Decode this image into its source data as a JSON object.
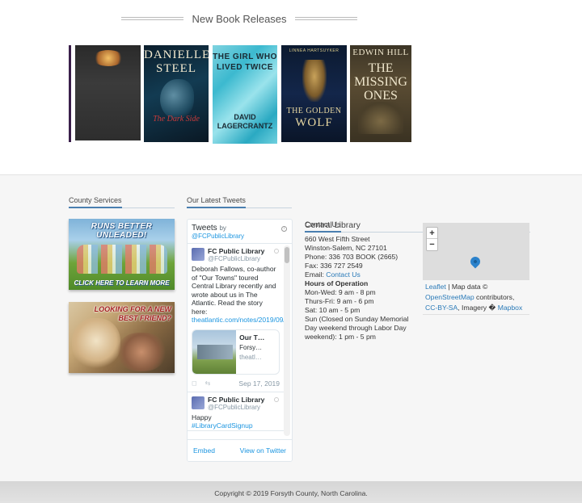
{
  "releases": {
    "title": "New Book Releases",
    "books": [
      {
        "title": "",
        "author": ""
      },
      {
        "author_line": "DANIELLE STEEL",
        "title": "The Dark Side"
      },
      {
        "title": "THE GIRL WHO LIVED TWICE",
        "author": "DAVID LAGERCRANTZ"
      },
      {
        "author": "LINNEA HARTSUYKER",
        "title_small": "THE GOLDEN",
        "title_big": "WOLF"
      },
      {
        "author": "EDWIN HILL",
        "title": "THE MISSING ONES"
      }
    ]
  },
  "county": {
    "title": "County Services",
    "promo1": {
      "headline": "RUNS BETTER UNLEADED!",
      "footer": "CLICK HERE TO LEARN MORE"
    },
    "promo2": {
      "headline": "LOOKING FOR A NEW BEST FRIEND?"
    }
  },
  "tweets": {
    "title": "Our Latest Tweets",
    "header_label": "Tweets",
    "header_by": "by",
    "header_handle": "@FCPublicLibrary",
    "info_icon": "i",
    "tweet1": {
      "name": "FC Public Library",
      "handle": "@FCPublicLibrary",
      "text": "Deborah Fallows, co-author of \"Our Towns\" toured Central Library recently and wrote about us in The Atlantic. Read the story here:",
      "link": "theatlantic.com/notes/2019/09/…",
      "card_title": "Our T…",
      "card_desc": "Forsy…",
      "card_url": "theatl…",
      "date": "Sep 17, 2019"
    },
    "tweet2": {
      "name": "FC Public Library",
      "handle": "@FCPublicLibrary",
      "text": "Happy",
      "hashtag": "#LibraryCardSignup"
    },
    "embed": "Embed",
    "view": "View on Twitter"
  },
  "contact": {
    "title": "Contact Us",
    "library": "Central Library",
    "address1": "660 West Fifth Street",
    "address2": "Winston-Salem, NC 27101",
    "phone": "Phone: 336 703 BOOK (2665)",
    "fax": "Fax: 336 727 2549",
    "email_label": "Email:",
    "email_link": "Contact Us",
    "hours_title": "Hours of Operation",
    "hours": [
      "Mon-Wed: 9 am - 8 pm",
      "Thurs-Fri: 9 am - 6 pm",
      "Sat: 10 am - 5 pm",
      "Sun (Closed on Sunday Memorial Day weekend through Labor Day weekend): 1 pm - 5 pm"
    ]
  },
  "map": {
    "zoom_in": "+",
    "zoom_out": "−",
    "attribution": {
      "leaflet": "Leaflet",
      "sep1": " | Map data © ",
      "osm": "OpenStreetMap",
      "contrib": " contributors, ",
      "ccbysa": "CC-BY-SA",
      "imagery": ", Imagery � ",
      "mapbox": "Mapbox"
    }
  },
  "footer": {
    "copyright": "Copyright © 2019 Forsyth County, North Carolina."
  }
}
